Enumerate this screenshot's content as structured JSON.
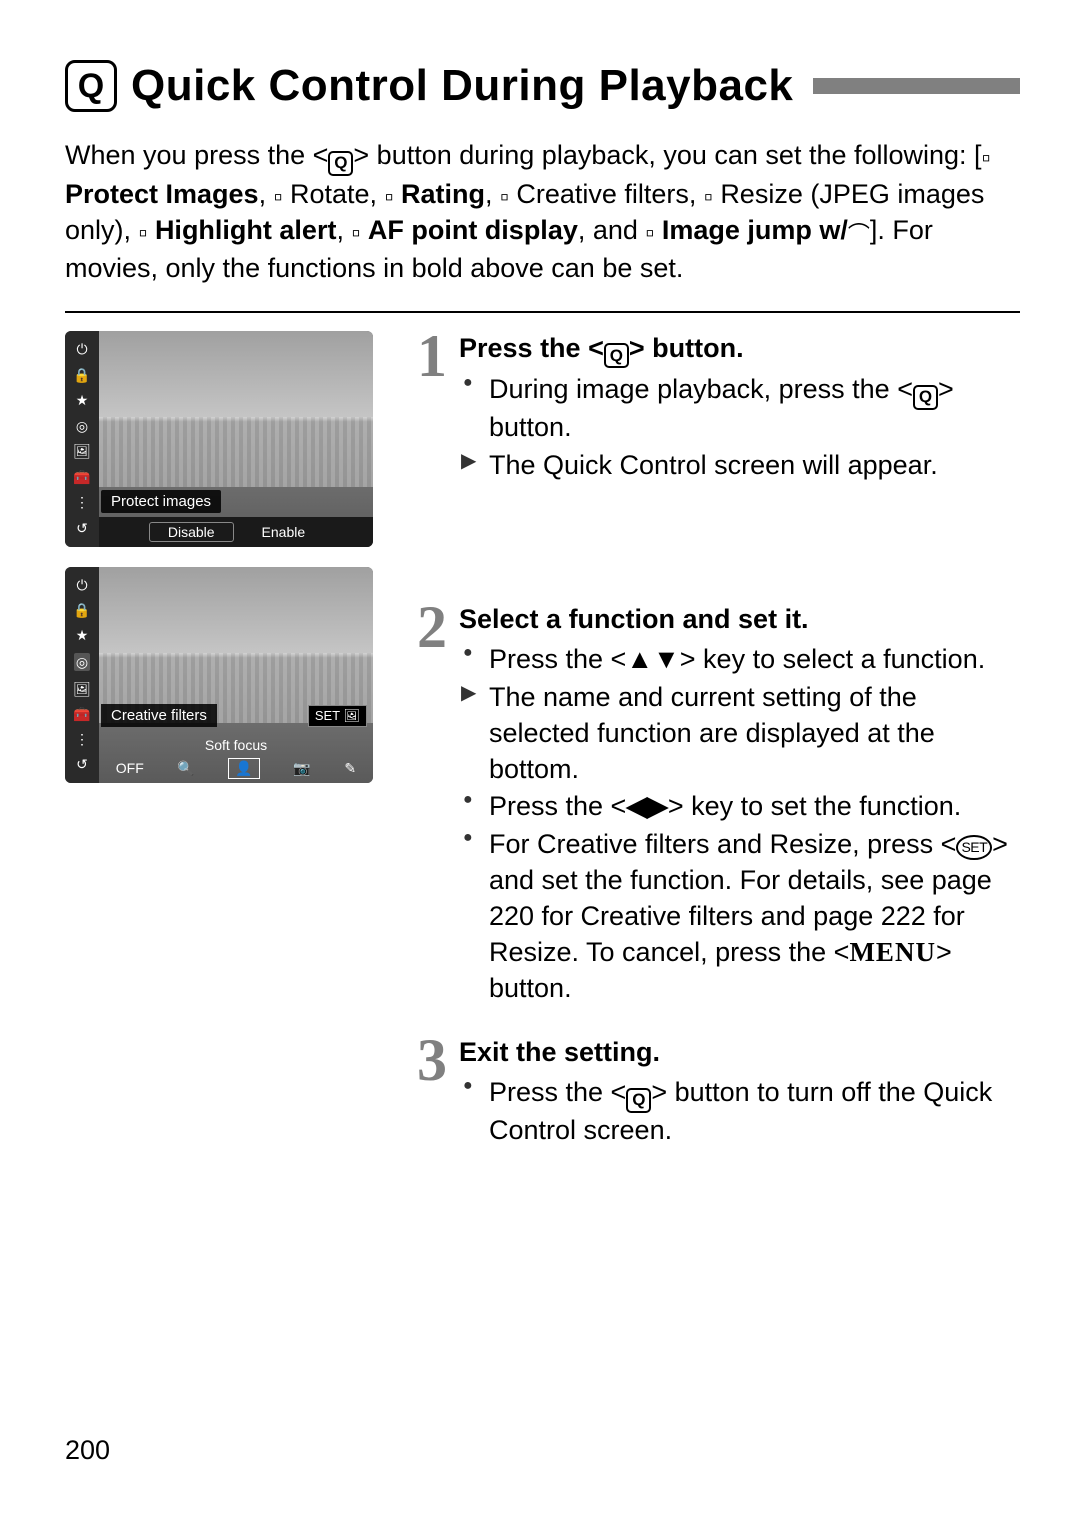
{
  "title": "Quick Control During Playback",
  "intro": {
    "leadA": "When you press the <",
    "leadB": "> button during playback, you can set the following: [",
    "protect": "Protect Images",
    "s1": ", ",
    "rotate": "Rotate",
    "s2": ", ",
    "rating": "Rating",
    "s3": ", ",
    "creative": "Creative filters",
    "s4": ", ",
    "resize": "Resize (JPEG images only)",
    "s5": ", ",
    "highlight": "Highlight alert",
    "s6": ", ",
    "afpoint": "AF point display",
    "s7": ", and ",
    "imagejump": "Image jump w/",
    "trail": "]. For movies, only the functions in bold above can be set."
  },
  "camA": {
    "label": "Protect images",
    "opt1": "Disable",
    "opt2": "Enable",
    "sideIcons": [
      "⏻",
      "🔒",
      "★",
      "◎",
      "🖼",
      "🧰",
      "⋮",
      "↺"
    ]
  },
  "camB": {
    "label": "Creative filters",
    "sub": "Soft focus",
    "set": "SET 🖼",
    "row": [
      "OFF",
      "🔍",
      "👤",
      "📷",
      "✎"
    ],
    "sideIcons": [
      "⏻",
      "🔒",
      "★",
      "◎",
      "🖼",
      "🧰",
      "⋮",
      "↺"
    ]
  },
  "step1": {
    "title": "Press the <Q> button.",
    "b1a": "During image playback, press the <",
    "b1b": "> button.",
    "b2": "The Quick Control screen will appear."
  },
  "step2": {
    "title": "Select a function and set it.",
    "b1a": "Press the <",
    "b1b": "> key to select a function.",
    "b2": "The name and current setting of the selected function are displayed at the bottom.",
    "b3a": "Press the <",
    "b3b": "> key to set the function.",
    "b4a": "For Creative filters and Resize, press <",
    "b4b": "> and set the function. For details, see page 220 for Creative filters and page 222 for Resize. To cancel, press the <",
    "b4c": "> button.",
    "menu": "MENU"
  },
  "step3": {
    "title": "Exit the setting.",
    "b1a": "Press the <",
    "b1b": "> button to turn off the Quick Control screen."
  },
  "pageNumber": "200"
}
